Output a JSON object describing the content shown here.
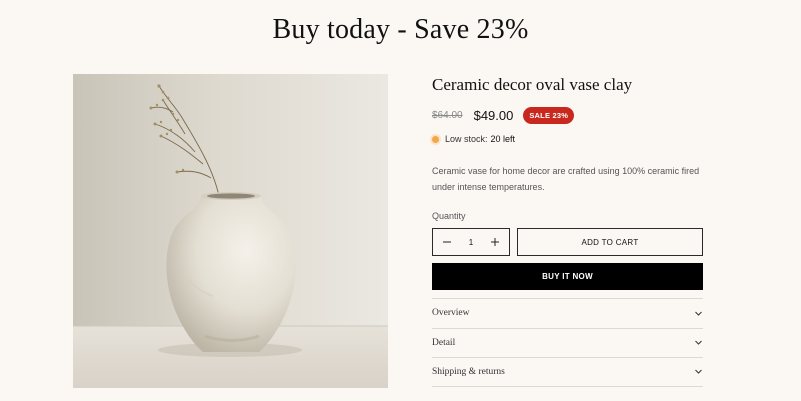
{
  "headline": "Buy today - Save 23%",
  "product": {
    "title": "Ceramic decor oval vase clay",
    "price_old": "$64.00",
    "price_new": "$49.00",
    "sale_badge": "SALE 23%",
    "stock_label": "Low stock:",
    "stock_count": "20 left",
    "description": "Ceramic vase for home decor are crafted using 100% ceramic fired under intense temperatures.",
    "quantity_label": "Quantity",
    "quantity_value": "1",
    "add_to_cart_label": "ADD TO CART",
    "buy_now_label": "BUY IT NOW"
  },
  "accordion": [
    {
      "label": "Overview"
    },
    {
      "label": "Detail"
    },
    {
      "label": "Shipping & returns"
    }
  ],
  "icons": {
    "minus": "minus-icon",
    "plus": "plus-icon",
    "chevron": "chevron-down-icon",
    "stock": "status-dot-icon"
  },
  "colors": {
    "background": "#fbf8f4",
    "sale_badge": "#c8281e",
    "stock_dot": "#f4a64a",
    "buy_now": "#000000"
  }
}
